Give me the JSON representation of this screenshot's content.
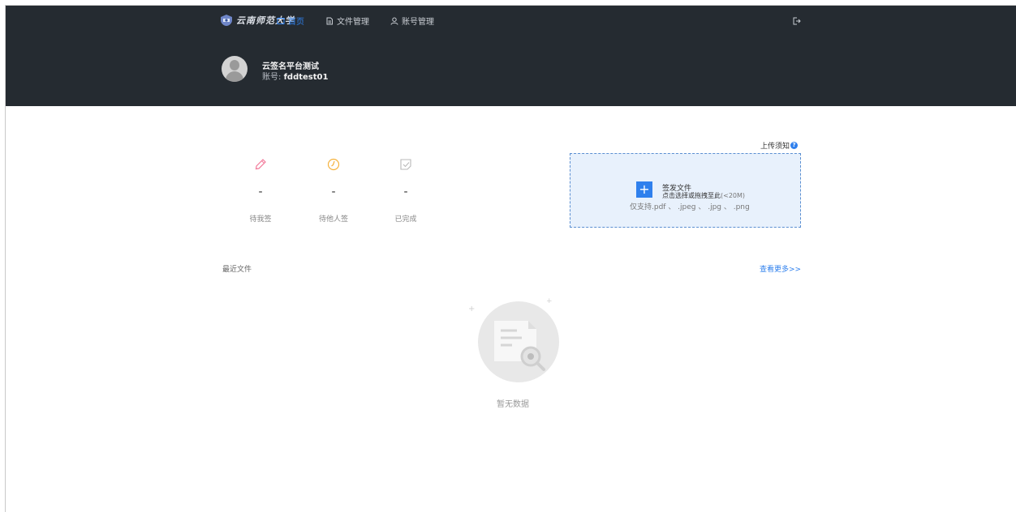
{
  "header": {
    "logo_text": "云南师范大学",
    "nav": [
      {
        "label": "首页",
        "icon": "home-icon",
        "active": true
      },
      {
        "label": "文件管理",
        "icon": "document-icon",
        "active": false
      },
      {
        "label": "账号管理",
        "icon": "user-icon",
        "active": false
      }
    ],
    "logout_icon": "logout-icon",
    "user": {
      "name": "云签名平台测试",
      "account_label": "账号:",
      "account_value": "fddtest01"
    }
  },
  "stats": [
    {
      "label": "待我签",
      "value": "-",
      "icon": "pencil-icon",
      "color": "#f27a9a"
    },
    {
      "label": "待他人签",
      "value": "-",
      "icon": "clock-icon",
      "color": "#f5b23d"
    },
    {
      "label": "已完成",
      "value": "-",
      "icon": "check-note-icon",
      "color": "#b9b9b9"
    }
  ],
  "upload": {
    "notice": "上传须知",
    "help_icon": "help-icon",
    "title": "签发文件",
    "hint": "点击选择或拖拽至此",
    "size_limit": "(<20M)",
    "formats": "仅支持.pdf 、 .jpeg 、 .jpg 、 .png",
    "accent": "#2f80ed"
  },
  "recent": {
    "title": "最近文件",
    "view_more": "查看更多>>",
    "empty_text": "暂无数据"
  },
  "colors": {
    "header_bg": "#252b31",
    "link": "#2f80ed"
  }
}
